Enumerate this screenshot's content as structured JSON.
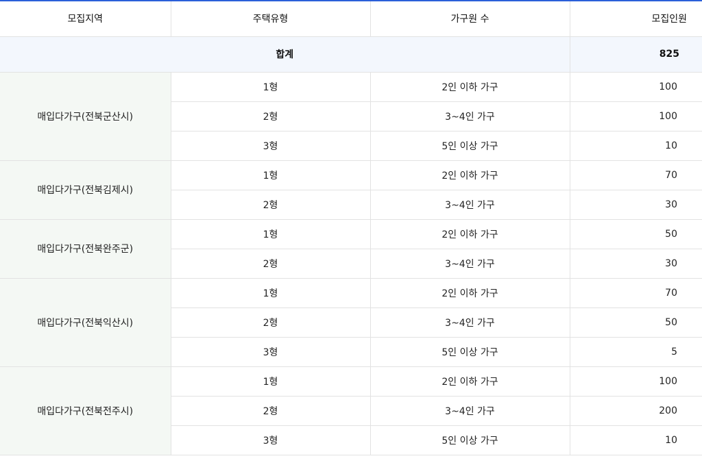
{
  "headers": {
    "region": "모집지역",
    "house_type": "주택유형",
    "household": "가구원 수",
    "recruit": "모집인원"
  },
  "total": {
    "label": "합계",
    "value": "825"
  },
  "regions": [
    {
      "name": "매입다가구(전북군산시)",
      "rows": [
        {
          "type": "1형",
          "household": "2인 이하 가구",
          "count": "100"
        },
        {
          "type": "2형",
          "household": "3~4인 가구",
          "count": "100"
        },
        {
          "type": "3형",
          "household": "5인 이상 가구",
          "count": "10"
        }
      ]
    },
    {
      "name": "매입다가구(전북김제시)",
      "rows": [
        {
          "type": "1형",
          "household": "2인 이하 가구",
          "count": "70"
        },
        {
          "type": "2형",
          "household": "3~4인 가구",
          "count": "30"
        }
      ]
    },
    {
      "name": "매입다가구(전북완주군)",
      "rows": [
        {
          "type": "1형",
          "household": "2인 이하 가구",
          "count": "50"
        },
        {
          "type": "2형",
          "household": "3~4인 가구",
          "count": "30"
        }
      ]
    },
    {
      "name": "매입다가구(전북익산시)",
      "rows": [
        {
          "type": "1형",
          "household": "2인 이하 가구",
          "count": "70"
        },
        {
          "type": "2형",
          "household": "3~4인 가구",
          "count": "50"
        },
        {
          "type": "3형",
          "household": "5인 이상 가구",
          "count": "5"
        }
      ]
    },
    {
      "name": "매입다가구(전북전주시)",
      "rows": [
        {
          "type": "1형",
          "household": "2인 이하 가구",
          "count": "100"
        },
        {
          "type": "2형",
          "household": "3~4인 가구",
          "count": "200"
        },
        {
          "type": "3형",
          "household": "5인 이상 가구",
          "count": "10"
        }
      ]
    }
  ],
  "colors": {
    "accent_border": "#2b5fd9",
    "total_row_bg": "#f3f7fd",
    "region_cell_bg": "#f4f8f4",
    "grid_line": "#e2e2e2"
  }
}
